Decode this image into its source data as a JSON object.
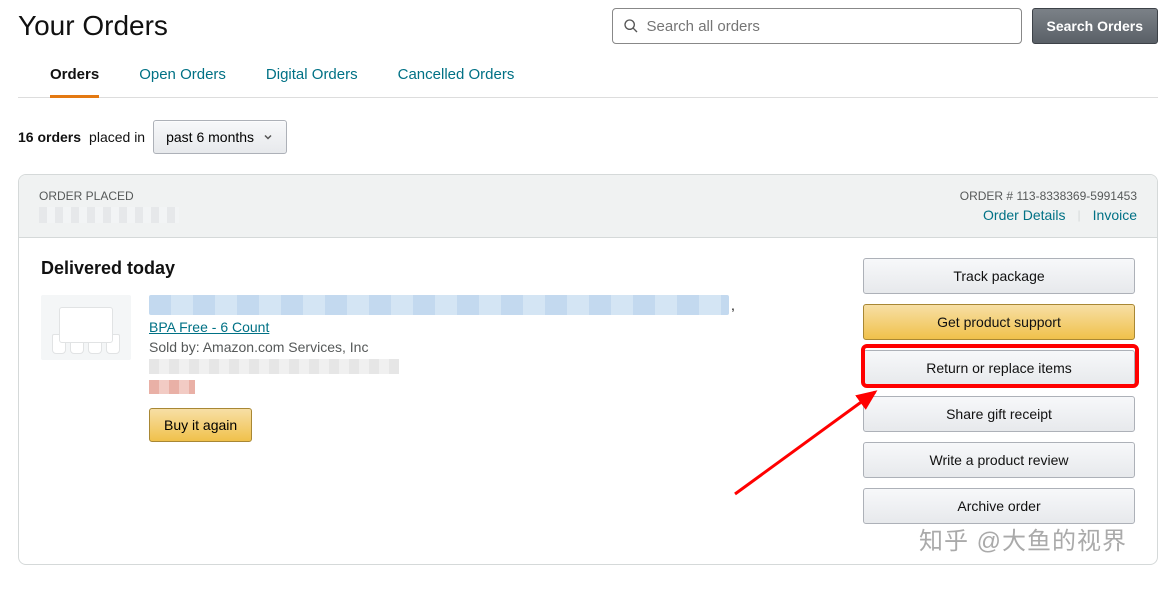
{
  "page": {
    "title": "Your Orders"
  },
  "search": {
    "placeholder": "Search all orders",
    "button_label": "Search Orders"
  },
  "tabs": [
    {
      "label": "Orders",
      "active": true
    },
    {
      "label": "Open Orders",
      "active": false
    },
    {
      "label": "Digital Orders",
      "active": false
    },
    {
      "label": "Cancelled Orders",
      "active": false
    }
  ],
  "filter": {
    "count_text": "16 orders",
    "placed_in_text": "placed in",
    "range_selected": "past 6 months"
  },
  "order": {
    "header": {
      "label_placed": "ORDER PLACED",
      "order_number_label": "ORDER #",
      "order_number": "113-8338369-5991453",
      "link_details": "Order Details",
      "link_invoice": "Invoice"
    },
    "delivered_title": "Delivered today",
    "item": {
      "title_visible_suffix": "BPA Free - 6 Count",
      "sold_by_prefix": "Sold by:",
      "sold_by_seller": "Amazon.com Services, Inc"
    },
    "buy_again_label": "Buy it again",
    "actions": {
      "track": "Track package",
      "support": "Get product support",
      "return": "Return or replace items",
      "share": "Share gift receipt",
      "review": "Write a product review",
      "archive": "Archive order"
    }
  },
  "watermark_text": "知乎 @大鱼的视界"
}
